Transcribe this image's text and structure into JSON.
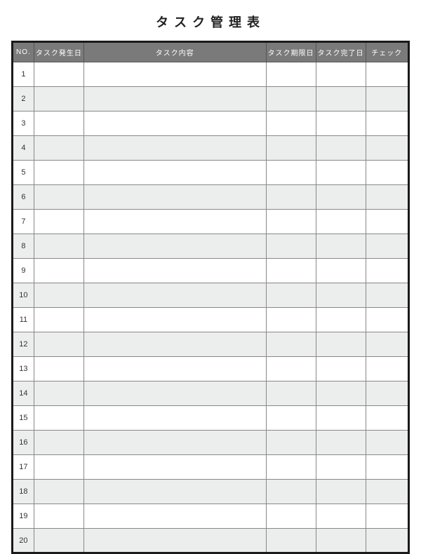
{
  "title": "タスク管理表",
  "columns": {
    "no": "NO.",
    "occur_date": "タスク発生日",
    "content": "タスク内容",
    "due_date": "タスク期限日",
    "done_date": "タスク完了日",
    "check": "チェック"
  },
  "rows": [
    {
      "no": "1",
      "occur_date": "",
      "content": "",
      "due_date": "",
      "done_date": "",
      "check": ""
    },
    {
      "no": "2",
      "occur_date": "",
      "content": "",
      "due_date": "",
      "done_date": "",
      "check": ""
    },
    {
      "no": "3",
      "occur_date": "",
      "content": "",
      "due_date": "",
      "done_date": "",
      "check": ""
    },
    {
      "no": "4",
      "occur_date": "",
      "content": "",
      "due_date": "",
      "done_date": "",
      "check": ""
    },
    {
      "no": "5",
      "occur_date": "",
      "content": "",
      "due_date": "",
      "done_date": "",
      "check": ""
    },
    {
      "no": "6",
      "occur_date": "",
      "content": "",
      "due_date": "",
      "done_date": "",
      "check": ""
    },
    {
      "no": "7",
      "occur_date": "",
      "content": "",
      "due_date": "",
      "done_date": "",
      "check": ""
    },
    {
      "no": "8",
      "occur_date": "",
      "content": "",
      "due_date": "",
      "done_date": "",
      "check": ""
    },
    {
      "no": "9",
      "occur_date": "",
      "content": "",
      "due_date": "",
      "done_date": "",
      "check": ""
    },
    {
      "no": "10",
      "occur_date": "",
      "content": "",
      "due_date": "",
      "done_date": "",
      "check": ""
    },
    {
      "no": "11",
      "occur_date": "",
      "content": "",
      "due_date": "",
      "done_date": "",
      "check": ""
    },
    {
      "no": "12",
      "occur_date": "",
      "content": "",
      "due_date": "",
      "done_date": "",
      "check": ""
    },
    {
      "no": "13",
      "occur_date": "",
      "content": "",
      "due_date": "",
      "done_date": "",
      "check": ""
    },
    {
      "no": "14",
      "occur_date": "",
      "content": "",
      "due_date": "",
      "done_date": "",
      "check": ""
    },
    {
      "no": "15",
      "occur_date": "",
      "content": "",
      "due_date": "",
      "done_date": "",
      "check": ""
    },
    {
      "no": "16",
      "occur_date": "",
      "content": "",
      "due_date": "",
      "done_date": "",
      "check": ""
    },
    {
      "no": "17",
      "occur_date": "",
      "content": "",
      "due_date": "",
      "done_date": "",
      "check": ""
    },
    {
      "no": "18",
      "occur_date": "",
      "content": "",
      "due_date": "",
      "done_date": "",
      "check": ""
    },
    {
      "no": "19",
      "occur_date": "",
      "content": "",
      "due_date": "",
      "done_date": "",
      "check": ""
    },
    {
      "no": "20",
      "occur_date": "",
      "content": "",
      "due_date": "",
      "done_date": "",
      "check": ""
    }
  ]
}
